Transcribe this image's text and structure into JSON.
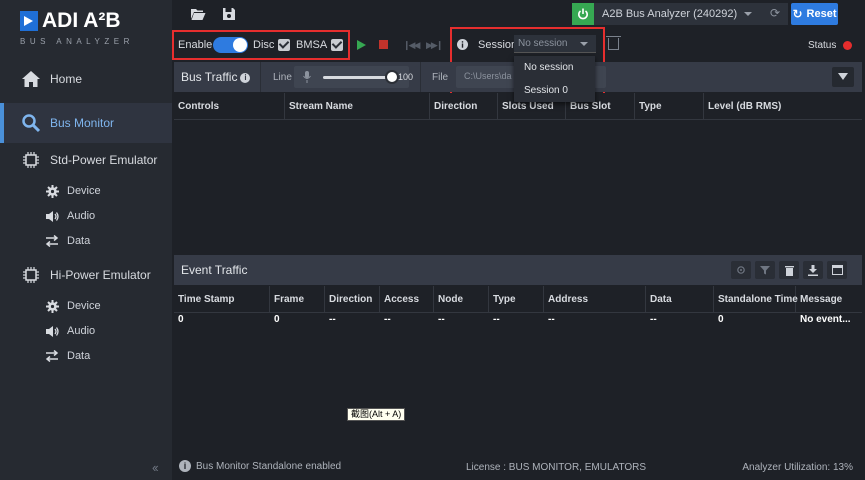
{
  "logo": {
    "brand": "ADI A²B",
    "subtitle": "BUS ANALYZER"
  },
  "sidebar": {
    "home": "Home",
    "bus_monitor": "Bus Monitor",
    "std_power": "Std-Power Emulator",
    "std_items": [
      "Device",
      "Audio",
      "Data"
    ],
    "hi_power": "Hi-Power Emulator",
    "hi_items": [
      "Device",
      "Audio",
      "Data"
    ]
  },
  "topbar": {
    "analyzer_name": "A2B Bus Analyzer (240292)",
    "reset_label": "Reset"
  },
  "toolbar": {
    "enable_label": "Enable",
    "disc_label": "Disc",
    "bmsa_label": "BMSA",
    "session_label": "Session",
    "session_value": "No session",
    "status_label": "Status"
  },
  "session_dropdown": {
    "options": [
      "No session",
      "Session 0"
    ]
  },
  "bus_traffic": {
    "title": "Bus Traffic",
    "line_label": "Line",
    "volume_value": "100",
    "file_label": "File",
    "file_value": "C:\\Users\\da",
    "columns": [
      "Controls",
      "Stream Name",
      "Direction",
      "Slots Used",
      "Bus Slot",
      "Type",
      "Level (dB RMS)"
    ]
  },
  "event_traffic": {
    "title": "Event Traffic",
    "columns": [
      "Time Stamp",
      "Frame",
      "Direction",
      "Access",
      "Node",
      "Type",
      "Address",
      "Data",
      "Standalone Time",
      "Message"
    ],
    "rows": [
      [
        "0",
        "0",
        "--",
        "--",
        "--",
        "--",
        "--",
        "--",
        "0",
        "No event..."
      ]
    ]
  },
  "tooltip": "截图(Alt + A)",
  "statusbar": {
    "info": "Bus Monitor Standalone enabled",
    "license": "License : BUS MONITOR, EMULATORS",
    "utilization": "Analyzer Utilization: 13%"
  },
  "colors": {
    "accent_blue": "#2e7be0",
    "power_green": "#36a852",
    "status_red": "#e52d2d",
    "highlight_box": "#e62e2e"
  }
}
